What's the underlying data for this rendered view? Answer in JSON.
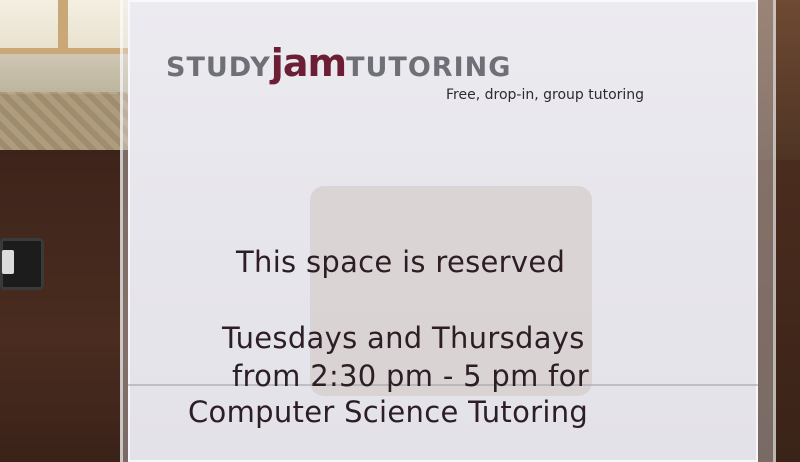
{
  "sign": {
    "logo": {
      "part1": "STUDY",
      "part2": "jam",
      "part3": "TUTORING"
    },
    "tagline": "Free, drop-in, group tutoring",
    "heading": "This space is reserved",
    "lines": [
      "Tuesdays and Thursdays",
      "from 2:30 pm - 5 pm for",
      "Computer Science Tutoring"
    ]
  },
  "colors": {
    "brand_maroon": "#6b1e34",
    "brand_gray": "#6f6f77",
    "text_dark": "#2d1e26",
    "paper": "#e7e6ec",
    "wood": "#4a2c20"
  }
}
